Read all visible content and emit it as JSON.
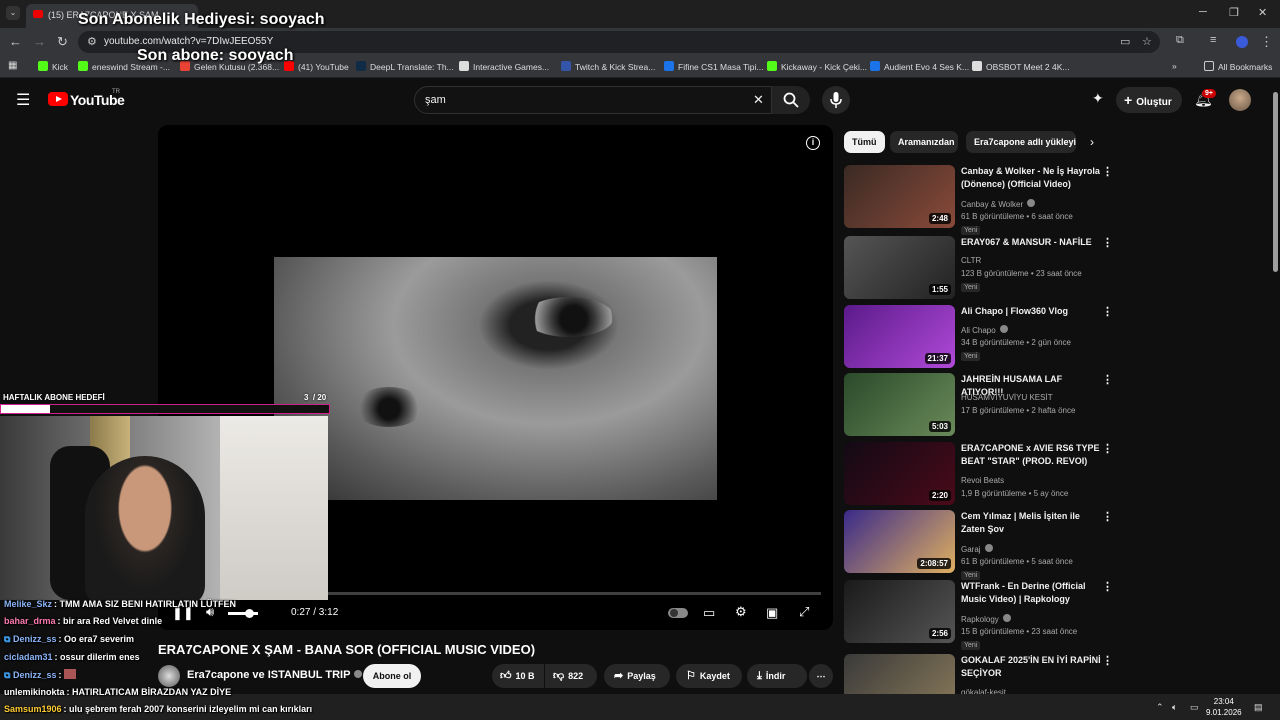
{
  "browser": {
    "tab_title": "(15) ERA7CAPONE X ŞAM",
    "url": "youtube.com/watch?v=7DIwJEEO55Y",
    "bookmarks": [
      {
        "label": "Kick",
        "color": "#53fc18"
      },
      {
        "label": "eneswind Stream -...",
        "color": "#53fc18"
      },
      {
        "label": "Gelen Kutusu (2.368...",
        "color": "#ea4335"
      },
      {
        "label": "(41) YouTube",
        "color": "#ff0000"
      },
      {
        "label": "DeepL Translate: Th...",
        "color": "#0f2b46"
      },
      {
        "label": "Interactive Games...",
        "color": "#dddddd"
      },
      {
        "label": "Twitch & Kick Strea...",
        "color": "#3355aa"
      },
      {
        "label": "Fifine CS1 Masa Tipi...",
        "color": "#1a73e8"
      },
      {
        "label": "Kickaway - Kick Çeki...",
        "color": "#53fc18"
      },
      {
        "label": "Audient Evo 4 Ses K...",
        "color": "#1a73e8"
      },
      {
        "label": "OBSBOT Meet 2 4K...",
        "color": "#dddddd"
      }
    ],
    "all_bookmarks": "All Bookmarks"
  },
  "stream_overlay": {
    "last_gift": "Son Abonelik Hediyesi: sooyach",
    "last_sub": "Son abone: sooyach",
    "goal_title": "HAFTALIK ABONE HEDEFİ",
    "goal_count": "3",
    "goal_total": "/ 20",
    "goal_fraction": 0.15
  },
  "chat": [
    {
      "user": "Melike_Skz",
      "color": "#8ab4f8",
      "text": ": TMM AMA SIZ BENI HATIRLATIN LÜTFEN"
    },
    {
      "user": "bahar_drma",
      "color": "#ff7ab2",
      "text": ": bir ara Red Velvet dinle"
    },
    {
      "user": "Denizz_ss",
      "color": "#8ab4f8",
      "text": ": Oo era7 severim"
    },
    {
      "user": "cicladam31",
      "color": "#8ab4f8",
      "text": ": ossur dilerim enes"
    },
    {
      "user": "Denizz_ss",
      "color": "#8ab4f8",
      "text": ":"
    },
    {
      "user": "unlemikinokta",
      "color": "#ffffff",
      "text": ": HATIRLATICAM BİRAZDAN YAZ DİYE"
    },
    {
      "user": "Samsum1906",
      "color": "#ffcc33",
      "text": ": ulu şebrem ferah 2007 konserini izleyelim mi can kırıkları"
    }
  ],
  "youtube": {
    "logo": "YouTube",
    "logo_sup": "TR",
    "search_value": "şam",
    "create_label": "Oluştur",
    "notif_badge": "9+",
    "player": {
      "time": "0:27 / 3:12",
      "progress_fraction": 0.14,
      "volume_fraction": 0.7
    },
    "video_title": "ERA7CAPONE X ŞAM - BANA SOR (OFFICIAL MUSIC VIDEO)",
    "channel": "Era7capone ve ISTANBUL TRIP",
    "subscribe": "Abone ol",
    "likes": "10 B",
    "dislikes": "822",
    "share": "Paylaş",
    "save": "Kaydet",
    "download": "İndir",
    "chips": [
      "Tümü",
      "Aramanızdan",
      "Era7capone adlı yükleyici"
    ],
    "recommendations": [
      {
        "title": "Canbay & Wolker - Ne İş Hayrola (Dönence) (Official Video)",
        "channel": "Canbay & Wolker",
        "verified": true,
        "meta": "61 B görüntüleme • 6 saat önce",
        "badge": "Yeni",
        "duration": "2:48",
        "colors": [
          "#3a2a24",
          "#8a4a3a"
        ]
      },
      {
        "title": "ERAY067 & MANSUR - NAFİLE",
        "channel": "CLTR",
        "verified": false,
        "meta": "123 B görüntüleme • 23 saat önce",
        "badge": "Yeni",
        "duration": "1:55",
        "colors": [
          "#555555",
          "#222222"
        ]
      },
      {
        "title": "Ali Chapo | Flow360 Vlog",
        "channel": "Ali Chapo",
        "verified": true,
        "meta": "34 B görüntüleme • 2 gün önce",
        "badge": "Yeni",
        "duration": "21:37",
        "colors": [
          "#5b1a8a",
          "#b04ad8"
        ]
      },
      {
        "title": "JAHREİN HUSAMA LAF ATIYOR!!!",
        "channel": "HUSAMVİYUVİYU KESİT",
        "verified": false,
        "meta": "17 B görüntüleme • 2 hafta önce",
        "badge": "",
        "duration": "5:03",
        "colors": [
          "#2a4a2a",
          "#6a8a5a"
        ]
      },
      {
        "title": "ERA7CAPONE x AVIE RS6 TYPE BEAT \"STAR\" (PROD. REVOI)",
        "channel": "Revoi Beats",
        "verified": false,
        "meta": "1,9 B görüntüleme • 5 ay önce",
        "badge": "",
        "duration": "2:20",
        "colors": [
          "#120a14",
          "#4a0a1a"
        ]
      },
      {
        "title": "Cem Yılmaz | Melis İşiten ile Zaten Şov",
        "channel": "Garaj",
        "verified": true,
        "meta": "61 B görüntüleme • 5 saat önce",
        "badge": "Yeni",
        "duration": "2:08:57",
        "colors": [
          "#3a2a8a",
          "#e0b060"
        ]
      },
      {
        "title": "WTFrank - En Derine (Official Music Video) | Rapkology",
        "channel": "Rapkology",
        "verified": true,
        "meta": "15 B görüntüleme • 23 saat önce",
        "badge": "Yeni",
        "duration": "2:56",
        "colors": [
          "#1a1a1a",
          "#555555"
        ]
      },
      {
        "title": "GOKALAF 2025'İN EN İYİ RAPİNİ SEÇİYOR",
        "channel": "gökalaf-kesit",
        "verified": false,
        "meta": "",
        "badge": "",
        "duration": "",
        "colors": [
          "#3a3a3a",
          "#8a7a5a"
        ]
      }
    ]
  },
  "taskbar": {
    "time": "23:04",
    "date": "9.01.2026"
  }
}
